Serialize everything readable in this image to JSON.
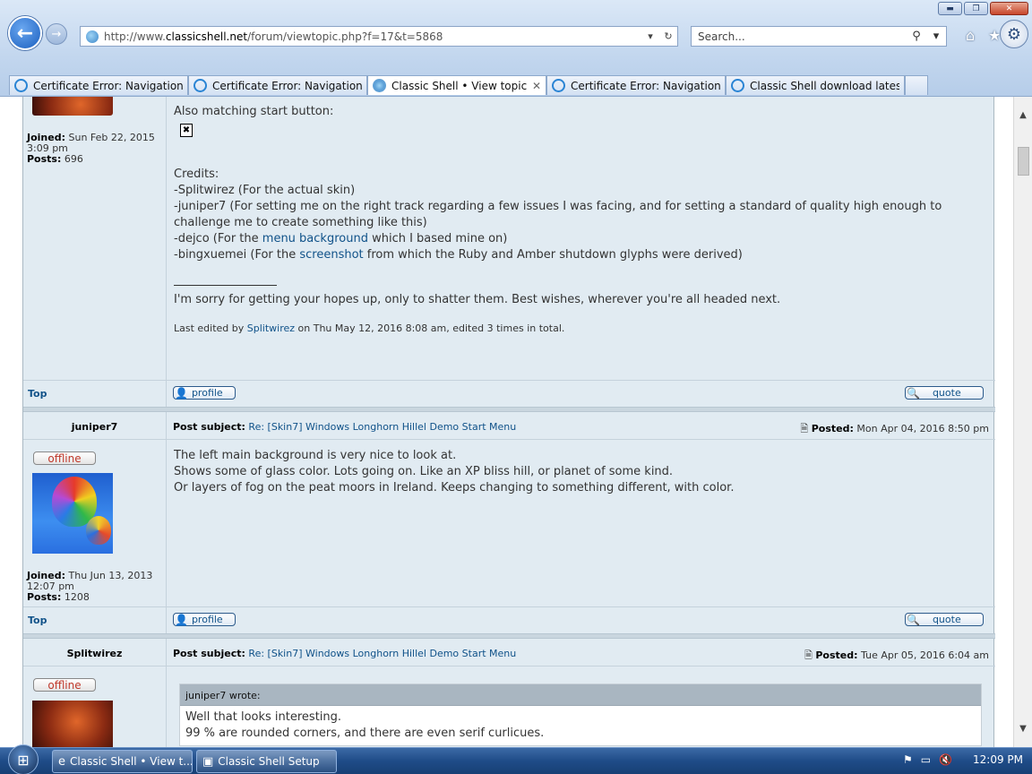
{
  "window": {
    "minimize": "▬",
    "maximize": "❐",
    "close": "✕"
  },
  "nav": {
    "back": "←",
    "forward": "→"
  },
  "address": {
    "url_prefix": "http://www.",
    "url_domain": "classicshell.net",
    "url_suffix": "/forum/viewtopic.php?f=17&t=5868",
    "dropdown": "▾",
    "refresh": "↻"
  },
  "search": {
    "placeholder": "Search...",
    "icon": "⚲",
    "dropdown": "▾"
  },
  "toolbar_icons": {
    "home": "⌂",
    "favorites": "★",
    "tools": "⚙"
  },
  "tabs": [
    {
      "title": "Certificate Error: Navigation Bl...",
      "kind": "ie"
    },
    {
      "title": "Certificate Error: Navigation Bl...",
      "kind": "ie"
    },
    {
      "title": "Classic Shell • View topic - [...",
      "kind": "cs",
      "active": true,
      "close": "✕"
    },
    {
      "title": "Certificate Error: Navigation Bl...",
      "kind": "ie"
    },
    {
      "title": "Classic Shell download latest v...",
      "kind": "ie"
    }
  ],
  "post1": {
    "joined_label": "Joined:",
    "joined_value": "Sun Feb 22, 2015",
    "joined_time": "3:09 pm",
    "posts_label": "Posts:",
    "posts_value": "696",
    "line_start_button": "Also matching start button:",
    "broken_image": "✖",
    "credits_heading": "Credits:",
    "credit1": "-Splitwirez (For the actual skin)",
    "credit2": "-juniper7 (For setting me on the right track regarding a few issues I was facing, and for setting a standard of quality high enough to challenge me to create something like this)",
    "credit3_pre": "-dejco (For the ",
    "credit3_link": "menu background",
    "credit3_post": " which I based mine on)",
    "credit4_pre": "-bingxuemei (For the ",
    "credit4_link": "screenshot",
    "credit4_post": " from which the Ruby and Amber shutdown glyphs were derived)",
    "signature": "I'm sorry for getting your hopes up, only to shatter them. Best wishes, wherever you're all headed next.",
    "edit_pre": "Last edited by ",
    "edit_user": "Splitwirez",
    "edit_post": " on Thu May 12, 2016 8:08 am, edited 3 times in total."
  },
  "footer": {
    "top": "Top",
    "profile": "profile",
    "quote": "quote",
    "profile_icon": "👤",
    "quote_icon": "🔍"
  },
  "post2": {
    "username": "juniper7",
    "subject_label": "Post subject:",
    "subject": "Re: [Skin7] Windows Longhorn Hillel Demo Start Menu",
    "posted_icon": "🗎",
    "posted_label": "Posted:",
    "posted": "Mon Apr 04, 2016 8:50 pm",
    "status": "offline",
    "joined_label": "Joined:",
    "joined_value": "Thu Jun 13, 2013",
    "joined_time": "12:07 pm",
    "posts_label": "Posts:",
    "posts_value": "1208",
    "line1": "The left main background is very nice to look at.",
    "line2": "Shows some of glass color. Lots going on. Like an XP bliss hill, or planet of some kind.",
    "line3": "Or layers of fog on the peat moors in Ireland. Keeps changing to something different, with color."
  },
  "post3": {
    "username": "Splitwirez",
    "subject_label": "Post subject:",
    "subject": "Re: [Skin7] Windows Longhorn Hillel Demo Start Menu",
    "posted_icon": "🗎",
    "posted_label": "Posted:",
    "posted": "Tue Apr 05, 2016 6:04 am",
    "status": "offline",
    "quote_header": "juniper7 wrote:",
    "quote_line1": "Well that looks interesting.",
    "quote_line2": "99 % are rounded corners, and there are even serif curlicues."
  },
  "scrollbar": {
    "up": "▲",
    "down": "▼"
  },
  "taskbar": {
    "start": "⊞",
    "task1": "Classic Shell • View t...",
    "task1_icon": "e",
    "task2": "Classic Shell Setup",
    "task2_icon": "▣",
    "tray_flag": "⚑",
    "tray_network": "▭",
    "tray_volume": "🔇",
    "clock": "12:09 PM"
  }
}
